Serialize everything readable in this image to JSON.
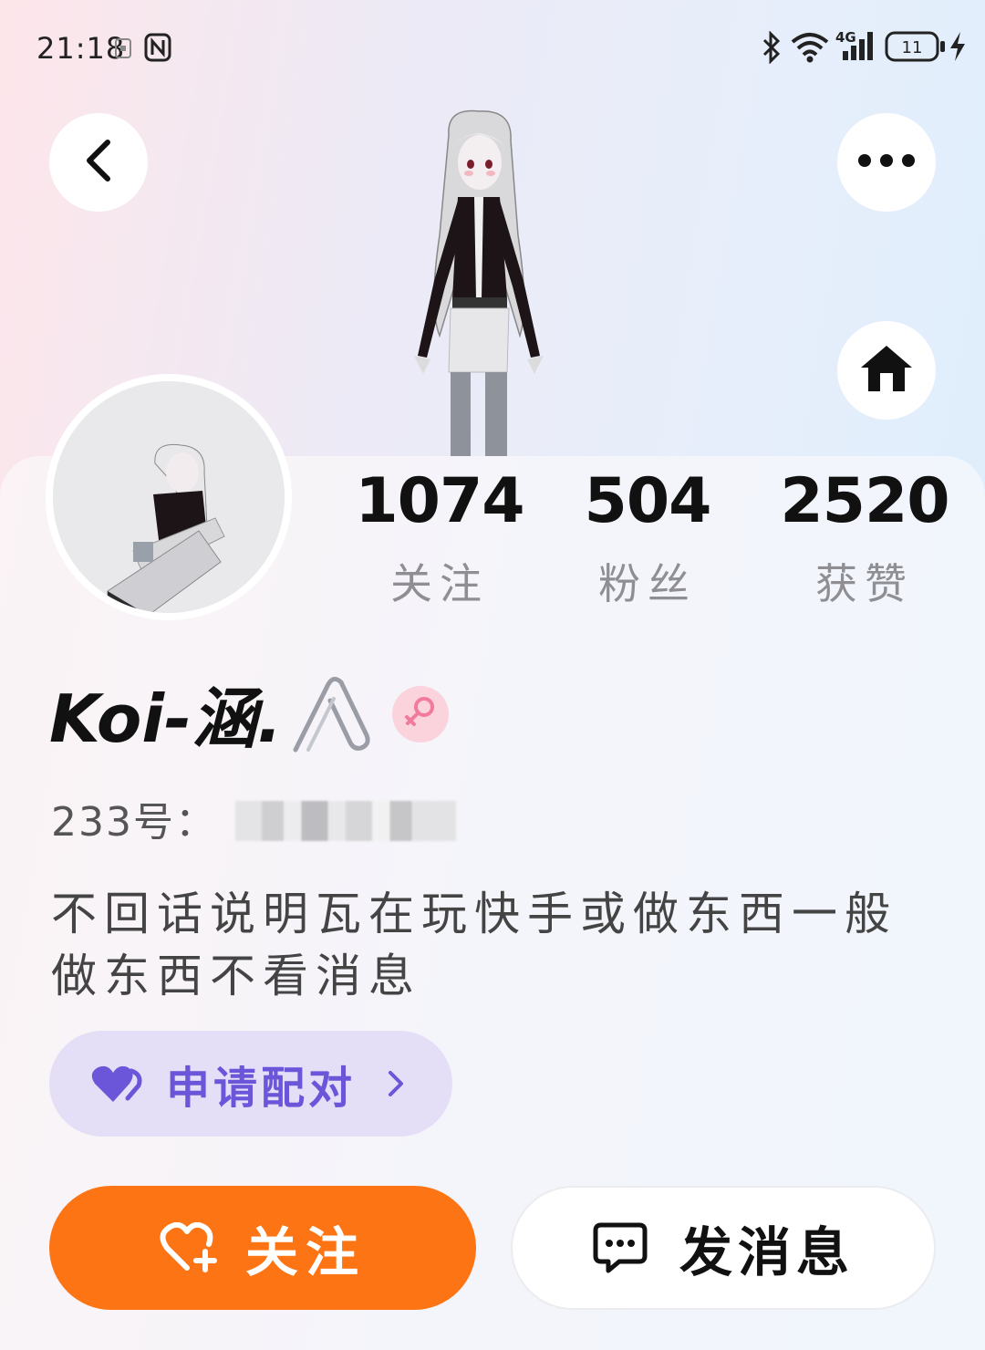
{
  "status_bar": {
    "time": "21:18",
    "icons": [
      "sim-card-icon",
      "nfc-icon",
      "bluetooth-icon",
      "wifi-icon",
      "signal-4g-icon",
      "battery-icon",
      "charging-icon"
    ],
    "network": "4G",
    "battery_level": "11"
  },
  "header": {
    "back_icon": "chevron-left-icon",
    "more_icon": "more-dots-icon",
    "home_icon": "home-icon"
  },
  "profile": {
    "stats": [
      {
        "value": "1074",
        "label": "关注"
      },
      {
        "value": "504",
        "label": "粉丝"
      },
      {
        "value": "2520",
        "label": "获赞"
      }
    ],
    "nickname": "Koi-涵.",
    "gender_icon": "female-icon",
    "id_label": "233号：",
    "bio": "不回话说明瓦在玩快手或做东西一般做东西不看消息"
  },
  "match": {
    "label": "申请配对"
  },
  "actions": {
    "follow_label": "关注",
    "message_label": "发消息"
  },
  "colors": {
    "accent_orange": "#fd7414",
    "match_purple": "#6b55d8",
    "match_bg": "#e4dff7",
    "gender_pink": "#f27a9b"
  }
}
